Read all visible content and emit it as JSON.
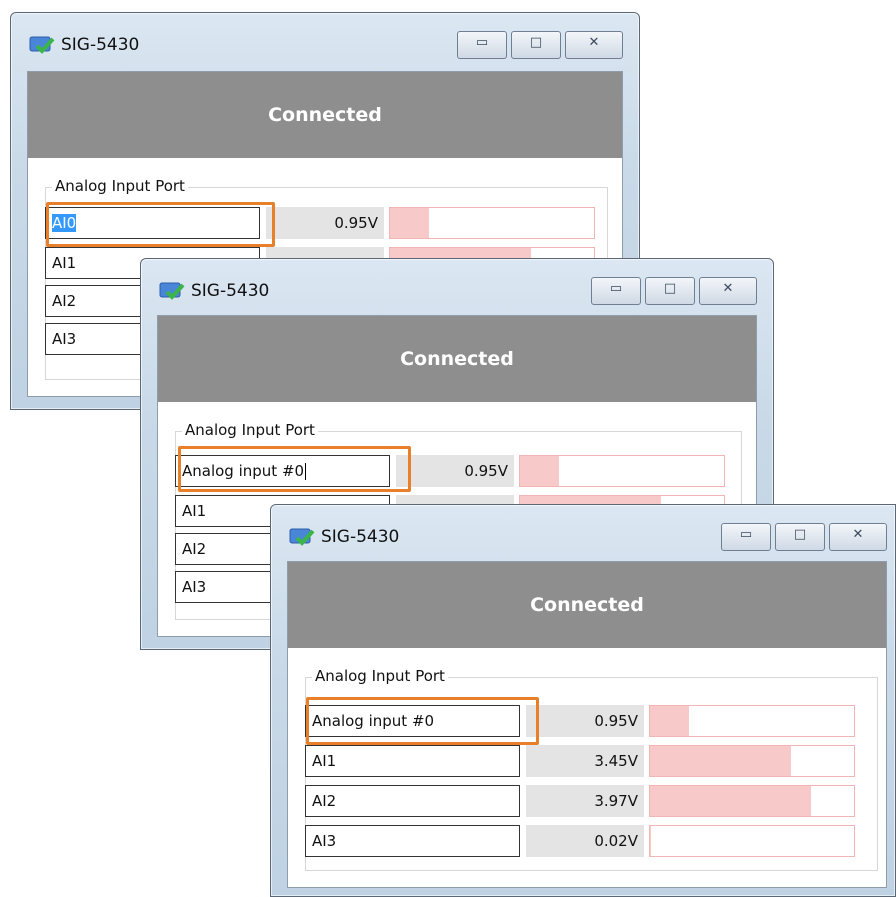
{
  "windows": [
    {
      "title": "SIG-5430",
      "status": "Connected",
      "group_label": "Analog Input Port",
      "first_channel_editing": true,
      "channels": [
        {
          "name": "AI0",
          "voltage": "0.95V",
          "level": 0.19
        },
        {
          "name": "AI1",
          "voltage": "",
          "level": 0.69
        },
        {
          "name": "AI2",
          "voltage": "",
          "level": 0
        },
        {
          "name": "AI3",
          "voltage": "",
          "level": 0
        }
      ]
    },
    {
      "title": "SIG-5430",
      "status": "Connected",
      "group_label": "Analog Input Port",
      "channels": [
        {
          "name": "Analog input #0",
          "voltage": "0.95V",
          "level": 0.19
        },
        {
          "name": "AI1",
          "voltage": "",
          "level": 0.69
        },
        {
          "name": "AI2",
          "voltage": "",
          "level": 0
        },
        {
          "name": "AI3",
          "voltage": "",
          "level": 0
        }
      ]
    },
    {
      "title": "SIG-5430",
      "status": "Connected",
      "group_label": "Analog Input Port",
      "channels": [
        {
          "name": "Analog input #0",
          "voltage": "0.95V",
          "level": 0.19
        },
        {
          "name": "AI1",
          "voltage": "3.45V",
          "level": 0.69
        },
        {
          "name": "AI2",
          "voltage": "3.97V",
          "level": 0.79
        },
        {
          "name": "AI3",
          "voltage": "0.02V",
          "level": 0.004
        }
      ]
    }
  ],
  "window_controls": {
    "minimize": "minimize-icon",
    "maximize": "maximize-icon",
    "close": "close-icon"
  },
  "colors": {
    "highlight": "#e87f2a",
    "bar_fill": "#f8c9c9",
    "status_bg": "#8e8e8e"
  }
}
